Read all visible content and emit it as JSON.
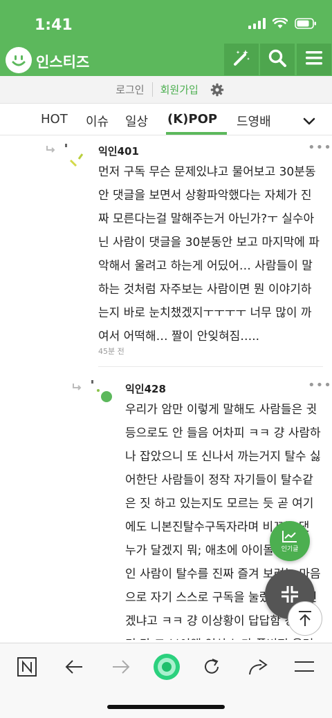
{
  "status": {
    "time": "1:41"
  },
  "header": {
    "app_title": "인스티즈"
  },
  "account": {
    "login": "로그인",
    "signup": "회원가입"
  },
  "tabs": [
    {
      "label": "HOT"
    },
    {
      "label": "이슈"
    },
    {
      "label": "일상"
    },
    {
      "label": "(K)POP"
    },
    {
      "label": "드영배"
    }
  ],
  "comments": [
    {
      "author": "익인401",
      "lines": [
        "먼저 구독 무슨 문제있냐고 물어보고 30분동",
        "안 댓글을 보면서 상황파악했다는 자체가 진",
        "짜 모른다는걸 말해주는거 아닌가?ㅜ 실수아",
        "닌 사람이 댓글을 30분동안 보고 마지막에 파",
        "악해서 울려고 하는게 어딨어… 사람들이 말",
        "하는 것처럼 자주보는 사람이면 뭔 이야기하",
        "는지 바로 눈치챘겠지ㅜㅜㅜㅜ 너무 많이 까",
        "여서 어떡해… 짤이 안잊혀짐….."
      ],
      "time": "45분 전"
    },
    {
      "author": "익인428",
      "lines": [
        "우리가 암만 이렇게 말해도 사람들은 귓",
        "등으로도 안 들음 어차피 ㅋㅋ 걍 사람하",
        "나 잡았으니 또 신나서 까는거지 탈수 싫",
        "어한단 사람들이 정작 자기들이 탈수같",
        "은 짓 하고 있는지도 모르는 듯 곧 여기",
        "에도 니본진탈수구독자라며 비꼬는 댓",
        "누가 달겠지 뭐; 애초에 아이돌 본인",
        "인 사람이 탈수를 진짜 즐겨 보려는 마음",
        "으로 자기 스스로 구독을 눌렀겠냐 본인",
        "겠냐고 ㅋㅋ 걍 이상황이 답답함 걍 빨",
        "리 걍 그 브이앱 영상 누가 풀버전 올려"
      ]
    }
  ],
  "fab": {
    "popular_label": "인기글"
  },
  "colors": {
    "brand": "#5cb85c",
    "brand_dark": "#4ea64e",
    "accent_fab": "#4caf50"
  },
  "icons": {
    "header": [
      "smile-logo-icon",
      "magic-wand-icon",
      "search-icon",
      "menu-icon"
    ],
    "bottom": [
      "n-box-icon",
      "back-arrow-icon",
      "forward-arrow-icon",
      "home-circle-icon",
      "refresh-icon",
      "share-icon",
      "menu-lines-icon"
    ]
  }
}
